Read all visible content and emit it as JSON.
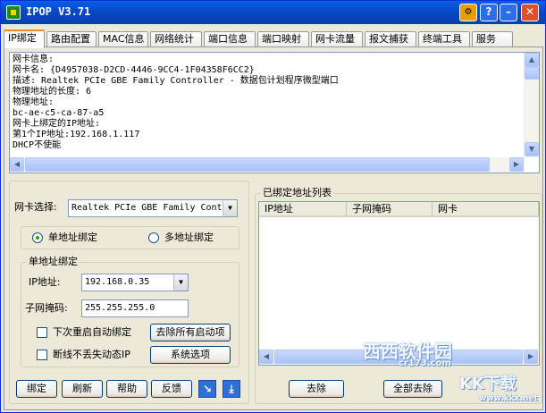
{
  "window": {
    "title": "IPOP V3.71",
    "buttons": {
      "tool": "⚙",
      "help": "?",
      "minimize": "–",
      "close": "✕"
    }
  },
  "tabs": [
    "IP绑定",
    "路由配置",
    "MAC信息",
    "网络统计",
    "端口信息",
    "端口映射",
    "网卡流量",
    "报文捕获",
    "终端工具",
    "服务"
  ],
  "info": {
    "lines": [
      "网卡信息:",
      "网卡名: {D4957038-D2CD-4446-9CC4-1F04358F6CC2}",
      "描述: Realtek PCIe GBE Family Controller - 数据包计划程序微型端口",
      "物理地址的长度: 6",
      "物理地址:",
      "bc-ae-c5-ca-87-a5",
      "网卡上绑定的IP地址:",
      "第1个IP地址:192.168.1.117",
      "DHCP不使能"
    ]
  },
  "adapter": {
    "label": "网卡选择:",
    "value": "Realtek PCIe GBE Family Controller"
  },
  "mode": {
    "single": "单地址绑定",
    "multi": "多地址绑定",
    "selected": "single"
  },
  "single_group": {
    "title": "单地址绑定",
    "ip_label": "IP地址:",
    "ip_value": "192.168.0.35",
    "mask_label": "子网掩码:",
    "mask_value": "255.255.255.0",
    "auto_bind_label": "下次重启自动绑定",
    "remove_startup_button": "去除所有启动项",
    "keep_dynamic_label": "断线不丢失动态IP",
    "system_options_button": "系统选项"
  },
  "buttons": {
    "bind": "绑定",
    "refresh": "刷新",
    "help": "帮助",
    "feedback": "反馈",
    "download_icon": "↘",
    "save_icon": "⤓",
    "remove": "去除",
    "remove_all": "全部去除"
  },
  "bound_list": {
    "title": "已绑定地址列表",
    "columns": [
      "IP地址",
      "子网掩码",
      "网卡"
    ]
  },
  "watermark": {
    "brand": "西西软件园",
    "site_sub": "cr173.com",
    "kk": "KK下载",
    "kk_url": "www.kkx.net"
  },
  "colors": {
    "titlebar": "#0A5FE8",
    "face": "#ECE9D8",
    "active_tab_accent": "#E68B2C"
  }
}
